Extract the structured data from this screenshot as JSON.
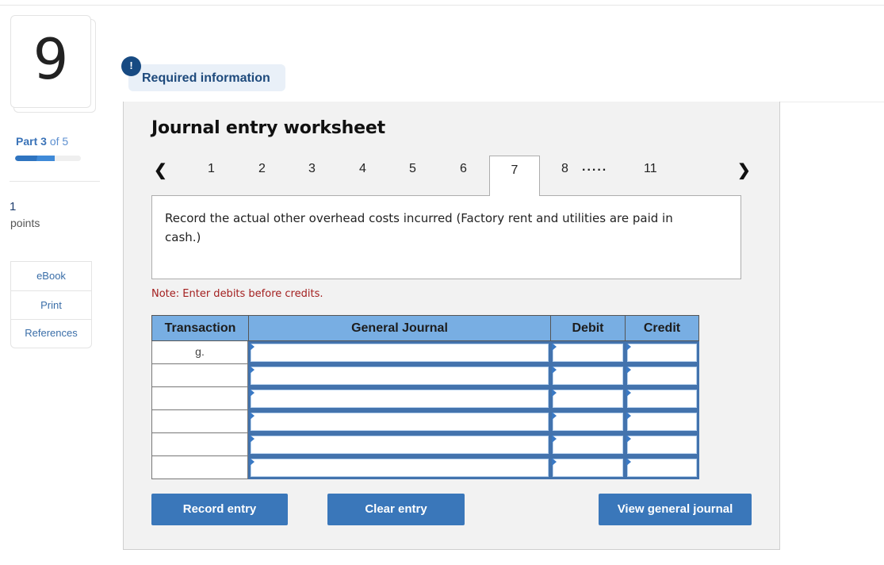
{
  "question": {
    "number": "9",
    "part_prefix": "Part",
    "part_current": "3",
    "part_suffix": "of 5",
    "progress_fraction": 0.6,
    "points_value": "1",
    "points_label": "points"
  },
  "sidebar": {
    "links": [
      {
        "label": "eBook"
      },
      {
        "label": "Print"
      },
      {
        "label": "References"
      }
    ]
  },
  "required_info": {
    "icon_glyph": "!",
    "label": "Required information"
  },
  "worksheet": {
    "title": "Journal entry worksheet",
    "pager": {
      "prev_glyph": "❮",
      "next_glyph": "❯",
      "pages": [
        "1",
        "2",
        "3",
        "4",
        "5",
        "6",
        "7",
        "8"
      ],
      "ellipsis": ".....",
      "last_page": "11",
      "active_page": "7"
    },
    "prompt": "Record the actual other overhead costs incurred (Factory rent and utilities are paid in cash.)",
    "note": "Note: Enter debits before credits.",
    "table": {
      "headers": {
        "transaction": "Transaction",
        "general_journal": "General Journal",
        "debit": "Debit",
        "credit": "Credit"
      },
      "rows": [
        {
          "transaction": "g.",
          "account": "",
          "debit": "",
          "credit": ""
        },
        {
          "transaction": "",
          "account": "",
          "debit": "",
          "credit": ""
        },
        {
          "transaction": "",
          "account": "",
          "debit": "",
          "credit": ""
        },
        {
          "transaction": "",
          "account": "",
          "debit": "",
          "credit": ""
        },
        {
          "transaction": "",
          "account": "",
          "debit": "",
          "credit": ""
        },
        {
          "transaction": "",
          "account": "",
          "debit": "",
          "credit": ""
        }
      ]
    },
    "buttons": {
      "record": "Record entry",
      "clear": "Clear entry",
      "view": "View general journal"
    }
  },
  "colors": {
    "accent_button": "#3a77ba",
    "table_header": "#78aee3",
    "note_red": "#a31f1f",
    "badge_bg": "#e9f0f8",
    "badge_icon": "#174a82"
  }
}
